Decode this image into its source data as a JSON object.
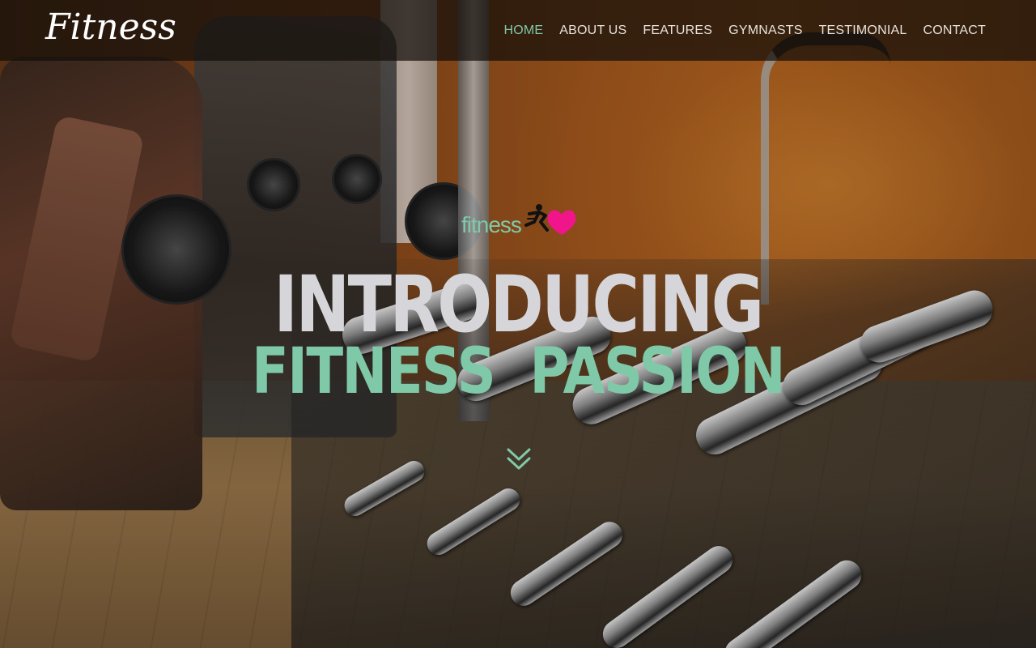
{
  "header": {
    "logo": "Fitness",
    "nav": [
      {
        "label": "HOME",
        "active": true
      },
      {
        "label": "ABOUT US",
        "active": false
      },
      {
        "label": "FEATURES",
        "active": false
      },
      {
        "label": "GYMNASTS",
        "active": false
      },
      {
        "label": "TESTIMONIAL",
        "active": false
      },
      {
        "label": "CONTACT",
        "active": false
      }
    ]
  },
  "hero": {
    "brand_text": "fitness",
    "brand_icon": "running-heart-icon",
    "title_line1": "INTRODUCING",
    "title_line2": "FITNESS  PASSION",
    "scroll_icon": "double-chevron-down-icon",
    "background": "gym-equipment-photo"
  },
  "colors": {
    "accent": "#7fc9a8",
    "heart": "#f0158a",
    "title_light": "#d6d6da",
    "nav_text": "#e8e3dc",
    "header_bg": "rgba(20,14,10,0.72)"
  }
}
